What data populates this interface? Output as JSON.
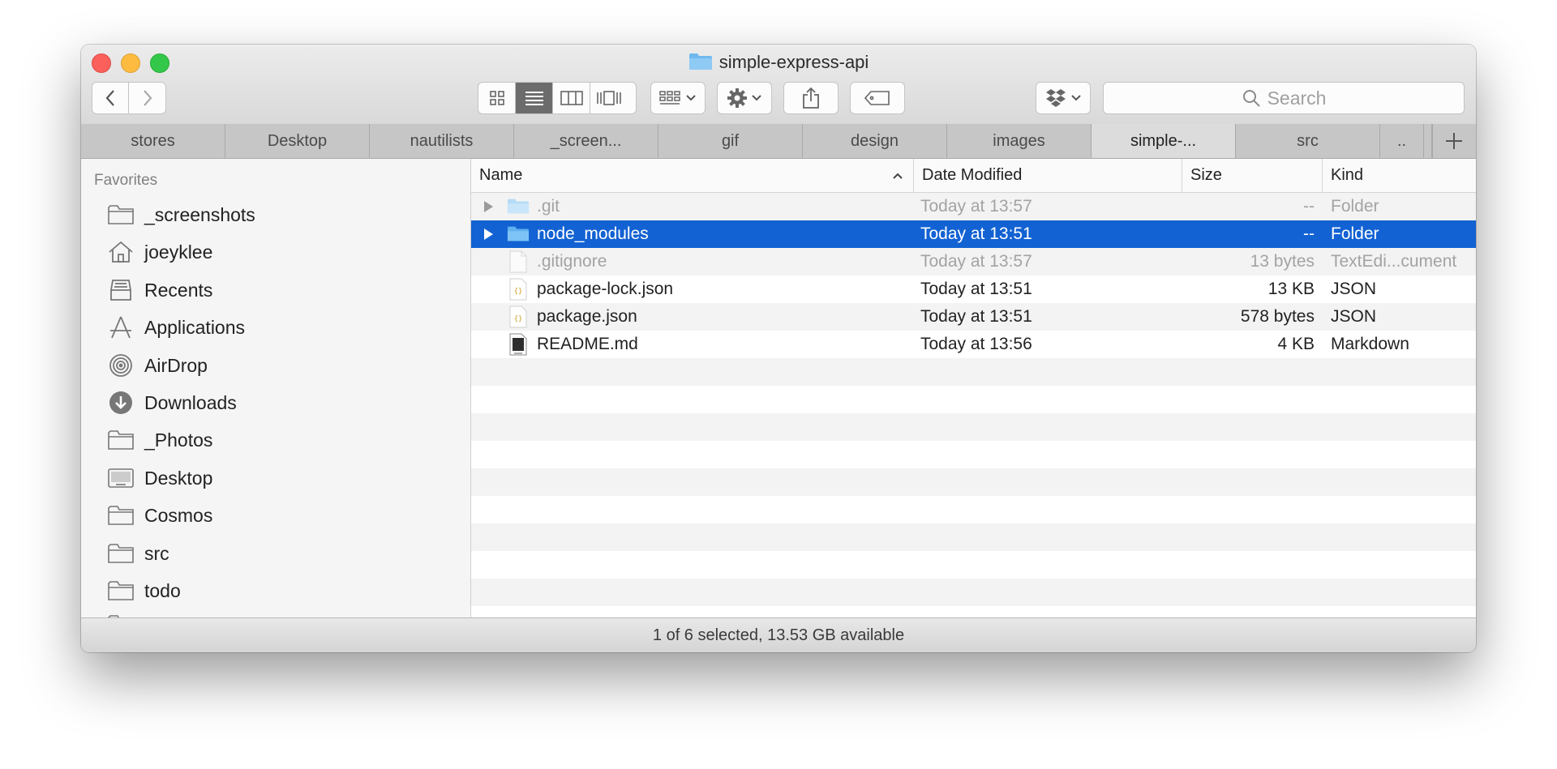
{
  "window": {
    "title": "simple-express-api"
  },
  "toolbar": {
    "search_placeholder": "Search",
    "view_modes": [
      "icon-view",
      "list-view",
      "column-view",
      "cover-flow-view"
    ],
    "active_view": "list-view"
  },
  "tabs": [
    {
      "label": "stores",
      "active": false
    },
    {
      "label": "Desktop",
      "active": false
    },
    {
      "label": "nautilists",
      "active": false
    },
    {
      "label": "_screen...",
      "active": false
    },
    {
      "label": "gif",
      "active": false
    },
    {
      "label": "design",
      "active": false
    },
    {
      "label": "images",
      "active": false
    },
    {
      "label": "simple-...",
      "active": true
    },
    {
      "label": "src",
      "active": false
    },
    {
      "label": "..",
      "active": false
    }
  ],
  "sidebar": {
    "heading": "Favorites",
    "items": [
      {
        "label": "_screenshots",
        "icon": "folder-icon"
      },
      {
        "label": "joeyklee",
        "icon": "home-icon"
      },
      {
        "label": "Recents",
        "icon": "recents-icon"
      },
      {
        "label": "Applications",
        "icon": "applications-icon"
      },
      {
        "label": "AirDrop",
        "icon": "airdrop-icon"
      },
      {
        "label": "Downloads",
        "icon": "downloads-icon"
      },
      {
        "label": "_Photos",
        "icon": "folder-icon"
      },
      {
        "label": "Desktop",
        "icon": "desktop-icon"
      },
      {
        "label": "Cosmos",
        "icon": "folder-icon"
      },
      {
        "label": "src",
        "icon": "folder-icon"
      },
      {
        "label": "todo",
        "icon": "folder-icon"
      }
    ]
  },
  "columns": {
    "name": "Name",
    "date": "Date Modified",
    "size": "Size",
    "kind": "Kind"
  },
  "files": [
    {
      "name": ".git",
      "date": "Today at 13:57",
      "size": "--",
      "kind": "Folder",
      "icon": "folder-icon",
      "expandable": true,
      "dim": true,
      "selected": false
    },
    {
      "name": "node_modules",
      "date": "Today at 13:51",
      "size": "--",
      "kind": "Folder",
      "icon": "folder-icon",
      "expandable": true,
      "dim": false,
      "selected": true
    },
    {
      "name": ".gitignore",
      "date": "Today at 13:57",
      "size": "13 bytes",
      "kind": "TextEdi...cument",
      "icon": "document-icon",
      "expandable": false,
      "dim": true,
      "selected": false
    },
    {
      "name": "package-lock.json",
      "date": "Today at 13:51",
      "size": "13 KB",
      "kind": "JSON",
      "icon": "json-file-icon",
      "expandable": false,
      "dim": false,
      "selected": false
    },
    {
      "name": "package.json",
      "date": "Today at 13:51",
      "size": "578 bytes",
      "kind": "JSON",
      "icon": "json-file-icon",
      "expandable": false,
      "dim": false,
      "selected": false
    },
    {
      "name": "README.md",
      "date": "Today at 13:56",
      "size": "4 KB",
      "kind": "Markdown",
      "icon": "markdown-file-icon",
      "expandable": false,
      "dim": false,
      "selected": false
    }
  ],
  "status": {
    "text": "1 of 6 selected, 13.53 GB available"
  },
  "colors": {
    "selection": "#1262d3",
    "folder": "#6fb8ef"
  }
}
